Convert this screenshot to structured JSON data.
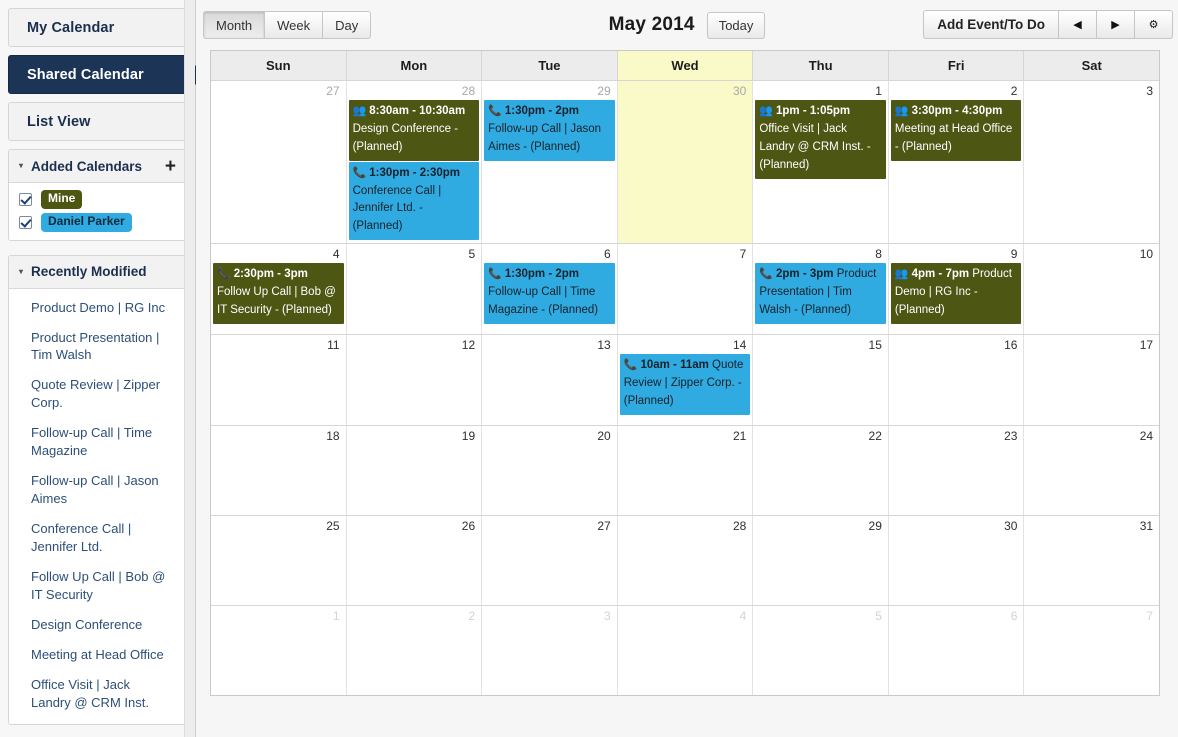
{
  "sidebar": {
    "tabs": [
      {
        "label": "My Calendar",
        "active": false
      },
      {
        "label": "Shared Calendar",
        "active": true
      },
      {
        "label": "List View",
        "active": false
      }
    ],
    "added_calendars": {
      "title": "Added Calendars",
      "add_label": "+",
      "caret": "▾",
      "items": [
        {
          "label": "Mine",
          "checked": true,
          "color": "#4e5614",
          "text_color": "#ffffff"
        },
        {
          "label": "Daniel Parker",
          "checked": true,
          "color": "#2fabe1",
          "text_color": "#10293a"
        }
      ]
    },
    "recently_modified": {
      "title": "Recently Modified",
      "caret": "▾",
      "items": [
        "Product Demo | RG Inc",
        "Product Presentation | Tim Walsh",
        "Quote Review | Zipper Corp.",
        "Follow-up Call | Time Magazine",
        "Follow-up Call | Jason Aimes",
        "Conference Call | Jennifer Ltd.",
        "Follow Up Call | Bob @ IT Security",
        "Design Conference",
        "Meeting at Head Office",
        "Office Visit | Jack Landry @ CRM Inst."
      ]
    }
  },
  "toolbar": {
    "views": [
      {
        "label": "Month",
        "pressed": true
      },
      {
        "label": "Week",
        "pressed": false
      },
      {
        "label": "Day",
        "pressed": false
      }
    ],
    "month_title": "May 2014",
    "today_label": "Today",
    "add_event_label": "Add Event/To Do",
    "prev_label": "◀",
    "next_label": "▶",
    "settings_label": "⚙"
  },
  "calendar": {
    "day_headers": [
      "Sun",
      "Mon",
      "Tue",
      "Wed",
      "Thu",
      "Fri",
      "Sat"
    ],
    "today_column_index": 3,
    "weeks": [
      {
        "days": [
          {
            "num": "27",
            "other": true,
            "today": false,
            "events": []
          },
          {
            "num": "28",
            "other": true,
            "today": false,
            "events": [
              {
                "color": "olive",
                "icon": "people-icon",
                "glyph": "👥",
                "time": "8:30am - 10:30am",
                "title": "Design Conference - (Planned)"
              },
              {
                "color": "blue",
                "icon": "phone-icon",
                "glyph": "📞",
                "time": "1:30pm - 2:30pm",
                "title": "Conference Call | Jennifer Ltd. - (Planned)"
              }
            ]
          },
          {
            "num": "29",
            "other": true,
            "today": false,
            "events": [
              {
                "color": "blue",
                "icon": "phone-icon",
                "glyph": "📞",
                "time": "1:30pm - 2pm",
                "title": "Follow-up Call | Jason Aimes - (Planned)"
              }
            ]
          },
          {
            "num": "30",
            "other": true,
            "today": true,
            "events": []
          },
          {
            "num": "1",
            "other": false,
            "today": false,
            "events": [
              {
                "color": "olive",
                "icon": "people-icon",
                "glyph": "👥",
                "time": "1pm - 1:05pm",
                "title": "Office Visit | Jack Landry @ CRM Inst. - (Planned)"
              }
            ]
          },
          {
            "num": "2",
            "other": false,
            "today": false,
            "events": [
              {
                "color": "olive",
                "icon": "people-icon",
                "glyph": "👥",
                "time": "3:30pm - 4:30pm",
                "title": "Meeting at Head Office - (Planned)"
              }
            ]
          },
          {
            "num": "3",
            "other": false,
            "today": false,
            "events": []
          }
        ]
      },
      {
        "days": [
          {
            "num": "4",
            "other": false,
            "today": false,
            "events": [
              {
                "color": "olive",
                "icon": "phone-icon",
                "glyph": "📞",
                "time": "2:30pm - 3pm",
                "title": "Follow Up Call | Bob @ IT Security - (Planned)"
              }
            ]
          },
          {
            "num": "5",
            "other": false,
            "today": false,
            "events": []
          },
          {
            "num": "6",
            "other": false,
            "today": false,
            "events": [
              {
                "color": "blue",
                "icon": "phone-icon",
                "glyph": "📞",
                "time": "1:30pm - 2pm",
                "title": "Follow-up Call | Time Magazine - (Planned)"
              }
            ]
          },
          {
            "num": "7",
            "other": false,
            "today": false,
            "events": []
          },
          {
            "num": "8",
            "other": false,
            "today": false,
            "events": [
              {
                "color": "blue",
                "icon": "phone-icon",
                "glyph": "📞",
                "time": "2pm - 3pm",
                "title": "Product Presentation | Tim Walsh - (Planned)"
              }
            ]
          },
          {
            "num": "9",
            "other": false,
            "today": false,
            "events": [
              {
                "color": "olive",
                "icon": "people-icon",
                "glyph": "👥",
                "time": "4pm - 7pm",
                "title": "Product Demo | RG Inc - (Planned)"
              }
            ]
          },
          {
            "num": "10",
            "other": false,
            "today": false,
            "events": []
          }
        ]
      },
      {
        "days": [
          {
            "num": "11",
            "other": false,
            "today": false,
            "events": []
          },
          {
            "num": "12",
            "other": false,
            "today": false,
            "events": []
          },
          {
            "num": "13",
            "other": false,
            "today": false,
            "events": []
          },
          {
            "num": "14",
            "other": false,
            "today": false,
            "events": [
              {
                "color": "blue",
                "icon": "phone-icon",
                "glyph": "📞",
                "time": "10am - 11am",
                "title": "Quote Review | Zipper Corp. - (Planned)"
              }
            ]
          },
          {
            "num": "15",
            "other": false,
            "today": false,
            "events": []
          },
          {
            "num": "16",
            "other": false,
            "today": false,
            "events": []
          },
          {
            "num": "17",
            "other": false,
            "today": false,
            "events": []
          }
        ]
      },
      {
        "days": [
          {
            "num": "18",
            "other": false,
            "today": false,
            "events": []
          },
          {
            "num": "19",
            "other": false,
            "today": false,
            "events": []
          },
          {
            "num": "20",
            "other": false,
            "today": false,
            "events": []
          },
          {
            "num": "21",
            "other": false,
            "today": false,
            "events": []
          },
          {
            "num": "22",
            "other": false,
            "today": false,
            "events": []
          },
          {
            "num": "23",
            "other": false,
            "today": false,
            "events": []
          },
          {
            "num": "24",
            "other": false,
            "today": false,
            "events": []
          }
        ]
      },
      {
        "days": [
          {
            "num": "25",
            "other": false,
            "today": false,
            "events": []
          },
          {
            "num": "26",
            "other": false,
            "today": false,
            "events": []
          },
          {
            "num": "27",
            "other": false,
            "today": false,
            "events": []
          },
          {
            "num": "28",
            "other": false,
            "today": false,
            "events": []
          },
          {
            "num": "29",
            "other": false,
            "today": false,
            "events": []
          },
          {
            "num": "30",
            "other": false,
            "today": false,
            "events": []
          },
          {
            "num": "31",
            "other": false,
            "today": false,
            "events": []
          }
        ]
      },
      {
        "days": [
          {
            "num": "1",
            "other": true,
            "faint": true,
            "today": false,
            "events": []
          },
          {
            "num": "2",
            "other": true,
            "faint": true,
            "today": false,
            "events": []
          },
          {
            "num": "3",
            "other": true,
            "faint": true,
            "today": false,
            "events": []
          },
          {
            "num": "4",
            "other": true,
            "faint": true,
            "today": false,
            "events": []
          },
          {
            "num": "5",
            "other": true,
            "faint": true,
            "today": false,
            "events": []
          },
          {
            "num": "6",
            "other": true,
            "faint": true,
            "today": false,
            "events": []
          },
          {
            "num": "7",
            "other": true,
            "faint": true,
            "today": false,
            "events": []
          }
        ]
      }
    ]
  },
  "colors": {
    "accent_navy": "#1c3557",
    "event_olive": "#4e5614",
    "event_blue": "#2fabe1",
    "today_bg": "#fafac8"
  }
}
